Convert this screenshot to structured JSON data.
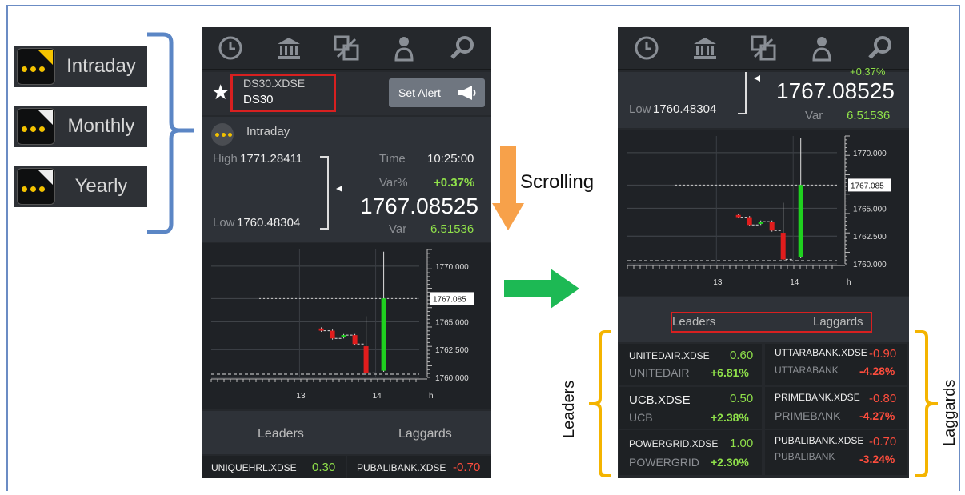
{
  "legend": [
    {
      "label": "Intraday",
      "corner": "yellow"
    },
    {
      "label": "Monthly",
      "corner": "white"
    },
    {
      "label": "Yearly",
      "corner": "white"
    }
  ],
  "annotations": {
    "scrolling": "Scrolling",
    "leaders": "Leaders",
    "laggards": "Laggards"
  },
  "colors": {
    "blue_bracket": "#5b86c5",
    "orange_arrow": "#f7a14a",
    "green_arrow": "#1db954",
    "gold_bracket": "#f4b400",
    "highlight_box": "#d82020"
  },
  "nav_icons": [
    "clock-icon",
    "bank-icon",
    "compare-icon",
    "user-icon",
    "search-icon"
  ],
  "screen1": {
    "symbol": "DS30.XDSE",
    "name": "DS30",
    "set_alert": "Set Alert",
    "period": "Intraday",
    "high_label": "High",
    "high_value": "1771.28411",
    "low_label": "Low",
    "low_value": "1760.48304",
    "time_label": "Time",
    "time_value": "10:25:00",
    "varpct_label": "Var%",
    "varpct_value": "+0.37%",
    "price": "1767.08525",
    "var_label": "Var",
    "var_value": "6.51536",
    "tabs": {
      "leaders": "Leaders",
      "laggards": "Laggards"
    },
    "row": {
      "left_symbol": "UNIQUEHRL.XDSE",
      "left_value": "0.30",
      "right_symbol": "PUBALIBANK.XDSE",
      "right_value": "-0.70"
    }
  },
  "screen2": {
    "low_label": "Low",
    "low_value": "1760.48304",
    "price": "1767.08525",
    "var_label": "Var",
    "var_value": "6.51536",
    "tabs": {
      "leaders": "Leaders",
      "laggards": "Laggards"
    },
    "leaders": [
      {
        "symbol": "UNITEDAIR.XDSE",
        "name": "UNITEDAIR",
        "value": "0.60",
        "pct": "+6.81%"
      },
      {
        "symbol": "UCB.XDSE",
        "name": "UCB",
        "value": "0.50",
        "pct": "+2.38%"
      },
      {
        "symbol": "POWERGRID.XDSE",
        "name": "POWERGRID",
        "value": "1.00",
        "pct": "+2.30%"
      }
    ],
    "laggards": [
      {
        "symbol": "UTTARABANK.XDSE",
        "name": "UTTARABANK",
        "value": "-0.90",
        "pct": "-4.28%"
      },
      {
        "symbol": "PRIMEBANK.XDSE",
        "name": "PRIMEBANK",
        "value": "-0.80",
        "pct": "-4.27%"
      },
      {
        "symbol": "PUBALIBANK.XDSE",
        "name": "PUBALIBANK",
        "value": "-0.70",
        "pct": "-3.24%"
      }
    ]
  },
  "chart_data": {
    "type": "candlestick",
    "y_ticks": [
      "1770.000",
      "1767.085",
      "1765.000",
      "1762.500",
      "1760.000"
    ],
    "x_ticks": [
      "13",
      "14",
      "h"
    ],
    "current_price_tag": "1767.085",
    "ylim": [
      1760,
      1771.5
    ],
    "candles": [
      {
        "open": 1764.4,
        "close": 1764.2,
        "high": 1764.5,
        "low": 1764.1,
        "color": "red"
      },
      {
        "open": 1764.2,
        "close": 1763.5,
        "high": 1764.3,
        "low": 1763.4,
        "color": "red"
      },
      {
        "open": 1763.6,
        "close": 1763.8,
        "high": 1763.9,
        "low": 1763.5,
        "color": "green"
      },
      {
        "open": 1763.8,
        "close": 1763.0,
        "high": 1763.9,
        "low": 1762.9,
        "color": "red"
      },
      {
        "open": 1762.8,
        "close": 1760.4,
        "high": 1765.5,
        "low": 1760.3,
        "color": "red"
      },
      {
        "open": 1760.6,
        "close": 1767.1,
        "high": 1771.3,
        "low": 1760.5,
        "color": "green"
      }
    ]
  }
}
